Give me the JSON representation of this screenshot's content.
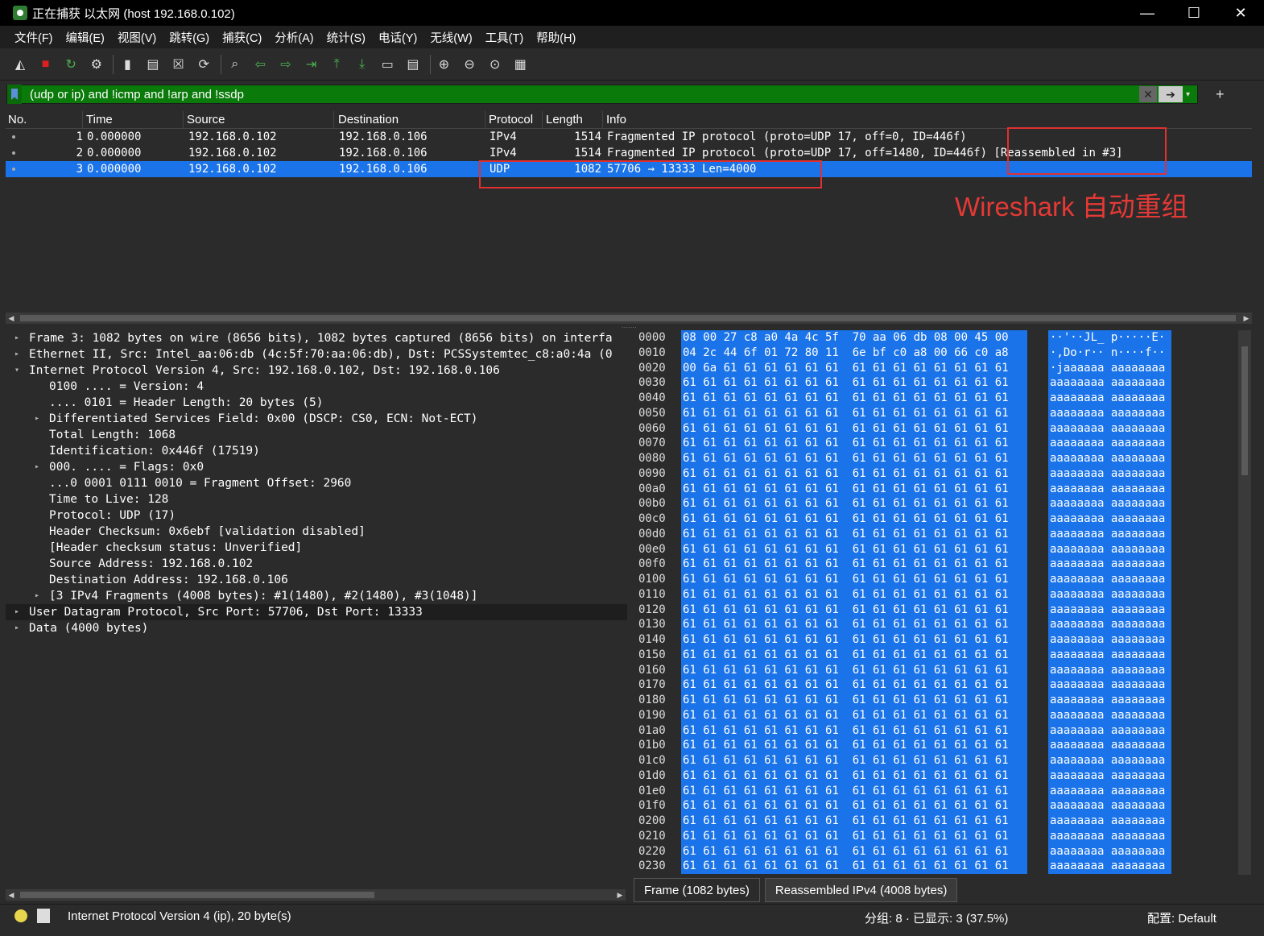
{
  "window": {
    "title": "正在捕获 以太网 (host 192.168.0.102)",
    "minimize": "—",
    "maximize": "☐",
    "close": "✕"
  },
  "menu": [
    "文件(F)",
    "编辑(E)",
    "视图(V)",
    "跳转(G)",
    "捕获(C)",
    "分析(A)",
    "统计(S)",
    "电话(Y)",
    "无线(W)",
    "工具(T)",
    "帮助(H)"
  ],
  "toolbar_icons": [
    "shark-fin-start-icon",
    "stop-capture-icon",
    "restart-capture-icon",
    "capture-options-icon",
    "open-file-icon",
    "save-file-icon",
    "close-file-icon",
    "reload-file-icon",
    "find-packet-icon",
    "go-back-icon",
    "go-forward-icon",
    "go-to-packet-icon",
    "first-packet-icon",
    "last-packet-icon",
    "auto-scroll-icon",
    "colorize-icon",
    "zoom-in-icon",
    "zoom-out-icon",
    "normal-size-icon",
    "resize-columns-icon"
  ],
  "filter": {
    "value": "(udp or ip) and !icmp and !arp and !ssdp",
    "clear": "✕",
    "apply": "➔",
    "dropdown": "▾",
    "add": "+"
  },
  "packet_list": {
    "columns": [
      "No.",
      "Time",
      "Source",
      "Destination",
      "Protocol",
      "Length",
      "Info"
    ],
    "rows": [
      {
        "no": "1",
        "time": "0.000000",
        "source": "192.168.0.102",
        "destination": "192.168.0.106",
        "protocol": "IPv4",
        "length": "1514",
        "info": "Fragmented IP protocol (proto=UDP 17, off=0, ID=446f)"
      },
      {
        "no": "2",
        "time": "0.000000",
        "source": "192.168.0.102",
        "destination": "192.168.0.106",
        "protocol": "IPv4",
        "length": "1514",
        "info": "Fragmented IP protocol (proto=UDP 17, off=1480, ID=446f) [Reassembled in #3]"
      },
      {
        "no": "3",
        "time": "0.000000",
        "source": "192.168.0.102",
        "destination": "192.168.0.106",
        "protocol": "UDP",
        "length": "1082",
        "info": "57706 → 13333 Len=4000"
      }
    ]
  },
  "annotation": "Wireshark 自动重组",
  "detail_tree": [
    {
      "text": "Frame 3: 1082 bytes on wire (8656 bits), 1082 bytes captured (8656 bits) on interfa",
      "arrow": "▸",
      "indent": 0
    },
    {
      "text": "Ethernet II, Src: Intel_aa:06:db (4c:5f:70:aa:06:db), Dst: PCSSystemtec_c8:a0:4a (0",
      "arrow": "▸",
      "indent": 0
    },
    {
      "text": "Internet Protocol Version 4, Src: 192.168.0.102, Dst: 192.168.0.106",
      "arrow": "▾",
      "indent": 0
    },
    {
      "text": "0100 .... = Version: 4",
      "arrow": "",
      "indent": 1
    },
    {
      "text": ".... 0101 = Header Length: 20 bytes (5)",
      "arrow": "",
      "indent": 1
    },
    {
      "text": "Differentiated Services Field: 0x00 (DSCP: CS0, ECN: Not-ECT)",
      "arrow": "▸",
      "indent": 1
    },
    {
      "text": "Total Length: 1068",
      "arrow": "",
      "indent": 1
    },
    {
      "text": "Identification: 0x446f (17519)",
      "arrow": "",
      "indent": 1
    },
    {
      "text": "000. .... = Flags: 0x0",
      "arrow": "▸",
      "indent": 1
    },
    {
      "text": "...0 0001 0111 0010 = Fragment Offset: 2960",
      "arrow": "",
      "indent": 1
    },
    {
      "text": "Time to Live: 128",
      "arrow": "",
      "indent": 1
    },
    {
      "text": "Protocol: UDP (17)",
      "arrow": "",
      "indent": 1
    },
    {
      "text": "Header Checksum: 0x6ebf [validation disabled]",
      "arrow": "",
      "indent": 1
    },
    {
      "text": "[Header checksum status: Unverified]",
      "arrow": "",
      "indent": 1
    },
    {
      "text": "Source Address: 192.168.0.102",
      "arrow": "",
      "indent": 1
    },
    {
      "text": "Destination Address: 192.168.0.106",
      "arrow": "",
      "indent": 1
    },
    {
      "text": "[3 IPv4 Fragments (4008 bytes): #1(1480), #2(1480), #3(1048)]",
      "arrow": "▸",
      "indent": 1
    },
    {
      "text": "User Datagram Protocol, Src Port: 57706, Dst Port: 13333",
      "arrow": "▸",
      "indent": 0
    },
    {
      "text": "Data (4000 bytes)",
      "arrow": "▸",
      "indent": 0
    }
  ],
  "hex_rows": [
    {
      "offset": "0000",
      "bytes": "08 00 27 c8 a0 4a 4c 5f  70 aa 06 db 08 00 45 00",
      "ascii": "··'··JL_ p·····E·"
    },
    {
      "offset": "0010",
      "bytes": "04 2c 44 6f 01 72 80 11  6e bf c0 a8 00 66 c0 a8",
      "ascii": "·,Do·r·· n····f··"
    },
    {
      "offset": "0020",
      "bytes": "00 6a 61 61 61 61 61 61  61 61 61 61 61 61 61 61",
      "ascii": "·jaaaaaa aaaaaaaa"
    },
    {
      "offset": "0030",
      "bytes": "61 61 61 61 61 61 61 61  61 61 61 61 61 61 61 61",
      "ascii": "aaaaaaaa aaaaaaaa"
    },
    {
      "offset": "0040",
      "bytes": "61 61 61 61 61 61 61 61  61 61 61 61 61 61 61 61",
      "ascii": "aaaaaaaa aaaaaaaa"
    },
    {
      "offset": "0050",
      "bytes": "61 61 61 61 61 61 61 61  61 61 61 61 61 61 61 61",
      "ascii": "aaaaaaaa aaaaaaaa"
    },
    {
      "offset": "0060",
      "bytes": "61 61 61 61 61 61 61 61  61 61 61 61 61 61 61 61",
      "ascii": "aaaaaaaa aaaaaaaa"
    },
    {
      "offset": "0070",
      "bytes": "61 61 61 61 61 61 61 61  61 61 61 61 61 61 61 61",
      "ascii": "aaaaaaaa aaaaaaaa"
    },
    {
      "offset": "0080",
      "bytes": "61 61 61 61 61 61 61 61  61 61 61 61 61 61 61 61",
      "ascii": "aaaaaaaa aaaaaaaa"
    },
    {
      "offset": "0090",
      "bytes": "61 61 61 61 61 61 61 61  61 61 61 61 61 61 61 61",
      "ascii": "aaaaaaaa aaaaaaaa"
    },
    {
      "offset": "00a0",
      "bytes": "61 61 61 61 61 61 61 61  61 61 61 61 61 61 61 61",
      "ascii": "aaaaaaaa aaaaaaaa"
    },
    {
      "offset": "00b0",
      "bytes": "61 61 61 61 61 61 61 61  61 61 61 61 61 61 61 61",
      "ascii": "aaaaaaaa aaaaaaaa"
    },
    {
      "offset": "00c0",
      "bytes": "61 61 61 61 61 61 61 61  61 61 61 61 61 61 61 61",
      "ascii": "aaaaaaaa aaaaaaaa"
    },
    {
      "offset": "00d0",
      "bytes": "61 61 61 61 61 61 61 61  61 61 61 61 61 61 61 61",
      "ascii": "aaaaaaaa aaaaaaaa"
    },
    {
      "offset": "00e0",
      "bytes": "61 61 61 61 61 61 61 61  61 61 61 61 61 61 61 61",
      "ascii": "aaaaaaaa aaaaaaaa"
    },
    {
      "offset": "00f0",
      "bytes": "61 61 61 61 61 61 61 61  61 61 61 61 61 61 61 61",
      "ascii": "aaaaaaaa aaaaaaaa"
    },
    {
      "offset": "0100",
      "bytes": "61 61 61 61 61 61 61 61  61 61 61 61 61 61 61 61",
      "ascii": "aaaaaaaa aaaaaaaa"
    },
    {
      "offset": "0110",
      "bytes": "61 61 61 61 61 61 61 61  61 61 61 61 61 61 61 61",
      "ascii": "aaaaaaaa aaaaaaaa"
    },
    {
      "offset": "0120",
      "bytes": "61 61 61 61 61 61 61 61  61 61 61 61 61 61 61 61",
      "ascii": "aaaaaaaa aaaaaaaa"
    },
    {
      "offset": "0130",
      "bytes": "61 61 61 61 61 61 61 61  61 61 61 61 61 61 61 61",
      "ascii": "aaaaaaaa aaaaaaaa"
    },
    {
      "offset": "0140",
      "bytes": "61 61 61 61 61 61 61 61  61 61 61 61 61 61 61 61",
      "ascii": "aaaaaaaa aaaaaaaa"
    },
    {
      "offset": "0150",
      "bytes": "61 61 61 61 61 61 61 61  61 61 61 61 61 61 61 61",
      "ascii": "aaaaaaaa aaaaaaaa"
    },
    {
      "offset": "0160",
      "bytes": "61 61 61 61 61 61 61 61  61 61 61 61 61 61 61 61",
      "ascii": "aaaaaaaa aaaaaaaa"
    },
    {
      "offset": "0170",
      "bytes": "61 61 61 61 61 61 61 61  61 61 61 61 61 61 61 61",
      "ascii": "aaaaaaaa aaaaaaaa"
    },
    {
      "offset": "0180",
      "bytes": "61 61 61 61 61 61 61 61  61 61 61 61 61 61 61 61",
      "ascii": "aaaaaaaa aaaaaaaa"
    },
    {
      "offset": "0190",
      "bytes": "61 61 61 61 61 61 61 61  61 61 61 61 61 61 61 61",
      "ascii": "aaaaaaaa aaaaaaaa"
    },
    {
      "offset": "01a0",
      "bytes": "61 61 61 61 61 61 61 61  61 61 61 61 61 61 61 61",
      "ascii": "aaaaaaaa aaaaaaaa"
    },
    {
      "offset": "01b0",
      "bytes": "61 61 61 61 61 61 61 61  61 61 61 61 61 61 61 61",
      "ascii": "aaaaaaaa aaaaaaaa"
    },
    {
      "offset": "01c0",
      "bytes": "61 61 61 61 61 61 61 61  61 61 61 61 61 61 61 61",
      "ascii": "aaaaaaaa aaaaaaaa"
    },
    {
      "offset": "01d0",
      "bytes": "61 61 61 61 61 61 61 61  61 61 61 61 61 61 61 61",
      "ascii": "aaaaaaaa aaaaaaaa"
    },
    {
      "offset": "01e0",
      "bytes": "61 61 61 61 61 61 61 61  61 61 61 61 61 61 61 61",
      "ascii": "aaaaaaaa aaaaaaaa"
    },
    {
      "offset": "01f0",
      "bytes": "61 61 61 61 61 61 61 61  61 61 61 61 61 61 61 61",
      "ascii": "aaaaaaaa aaaaaaaa"
    },
    {
      "offset": "0200",
      "bytes": "61 61 61 61 61 61 61 61  61 61 61 61 61 61 61 61",
      "ascii": "aaaaaaaa aaaaaaaa"
    },
    {
      "offset": "0210",
      "bytes": "61 61 61 61 61 61 61 61  61 61 61 61 61 61 61 61",
      "ascii": "aaaaaaaa aaaaaaaa"
    },
    {
      "offset": "0220",
      "bytes": "61 61 61 61 61 61 61 61  61 61 61 61 61 61 61 61",
      "ascii": "aaaaaaaa aaaaaaaa"
    },
    {
      "offset": "0230",
      "bytes": "61 61 61 61 61 61 61 61  61 61 61 61 61 61 61 61",
      "ascii": "aaaaaaaa aaaaaaaa"
    }
  ],
  "bytes_tabs": [
    "Frame (1082 bytes)",
    "Reassembled IPv4 (4008 bytes)"
  ],
  "status": {
    "field": "Internet Protocol Version 4 (ip), 20 byte(s)",
    "packets": "分组: 8 · 已显示: 3 (37.5%)",
    "profile": "配置: Default"
  },
  "colors": {
    "selection": "#1a73e8",
    "filter_valid": "#0a7a0a",
    "annotation": "#e53935"
  }
}
